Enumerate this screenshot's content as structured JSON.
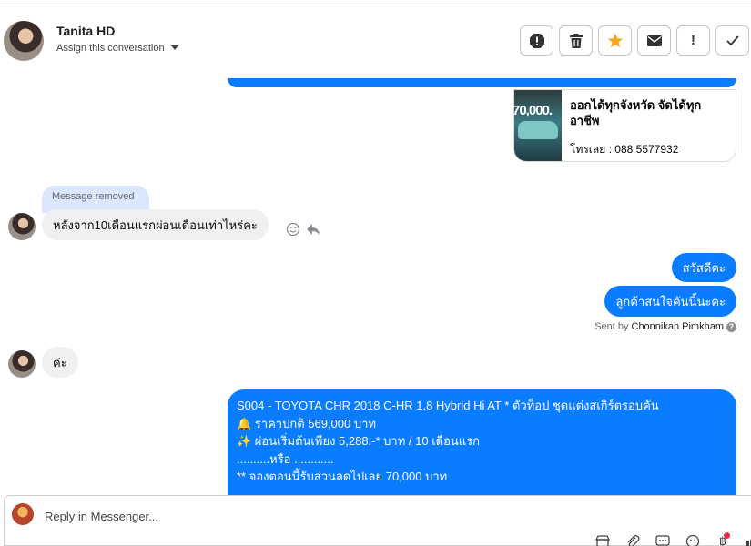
{
  "header": {
    "contact_name": "Tanita HD",
    "assign_label": "Assign this conversation",
    "actions": [
      {
        "name": "report-spam-icon"
      },
      {
        "name": "trash-icon"
      },
      {
        "name": "star-icon",
        "color": "#f5a623"
      },
      {
        "name": "envelope-icon"
      },
      {
        "name": "exclamation-icon",
        "label": "!"
      },
      {
        "name": "checkmark-icon"
      }
    ]
  },
  "chat": {
    "link_card": {
      "title": "ออกได้ทุกจังหวัด จัดได้ทุกอาชีพ",
      "phone": "โทรเลย : 088 5577932",
      "thumb_text": "70,000."
    },
    "removed_label": "Message removed",
    "incoming_question": "หลังจาก10เดือนแรกผ่อนเดือนเท่าไหร่คะ",
    "outgoing_greeting": "สวัสดีคะ",
    "outgoing_interest": "ลูกค้าสนใจคันนี้นะคะ",
    "sent_by_prefix": "Sent by",
    "sent_by_name": "Chonnikan Pimkham",
    "help_mark": "?",
    "incoming_reply": "ค่ะ",
    "listing": {
      "line1": "S004 - TOYOTA CHR 2018 C-HR 1.8 Hybrid Hi AT  * ตัวท็อป ชุดแต่งสเกิร์ตรอบคัน",
      "line2": "🔔 ราคาปกติ 569,000 บาท",
      "line3": "✨ ผ่อนเริ่มต้นเพียง 5,288.-* บาท / 10 เดือนแรก",
      "line4": "..........หรือ ............",
      "line5": "** จองตอนนี้รับส่วนลดไปเลย 70,000 บาท"
    }
  },
  "composer": {
    "placeholder": "Reply in Messenger...",
    "tools": [
      "store-icon",
      "paperclip-icon",
      "chat-bubble-icon",
      "emoji-icon",
      "baht-icon",
      "thumbs-up-icon"
    ]
  },
  "colors": {
    "accent": "#0a7cff",
    "incoming_bubble": "#f0f0f0",
    "removed_bubble": "#dbe7ff",
    "star": "#f5a623",
    "notification": "#f02849"
  }
}
